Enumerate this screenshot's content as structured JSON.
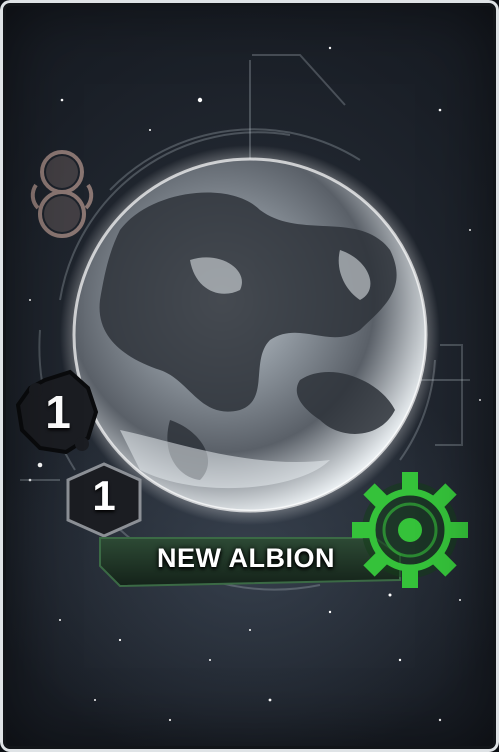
{
  "planet": {
    "name": "NEW ALBION",
    "primary_value": "1",
    "secondary_value": "1"
  },
  "icons": {
    "influence": "influence-token-icon",
    "trait": "green-gear-trait-icon"
  },
  "colors": {
    "background": "#1a1f27",
    "frame": "#dfe3e6",
    "banner": "#22382a",
    "trait_green": "#35c23a",
    "influence_brown": "#8a7672",
    "badge": "#1b1d22"
  }
}
